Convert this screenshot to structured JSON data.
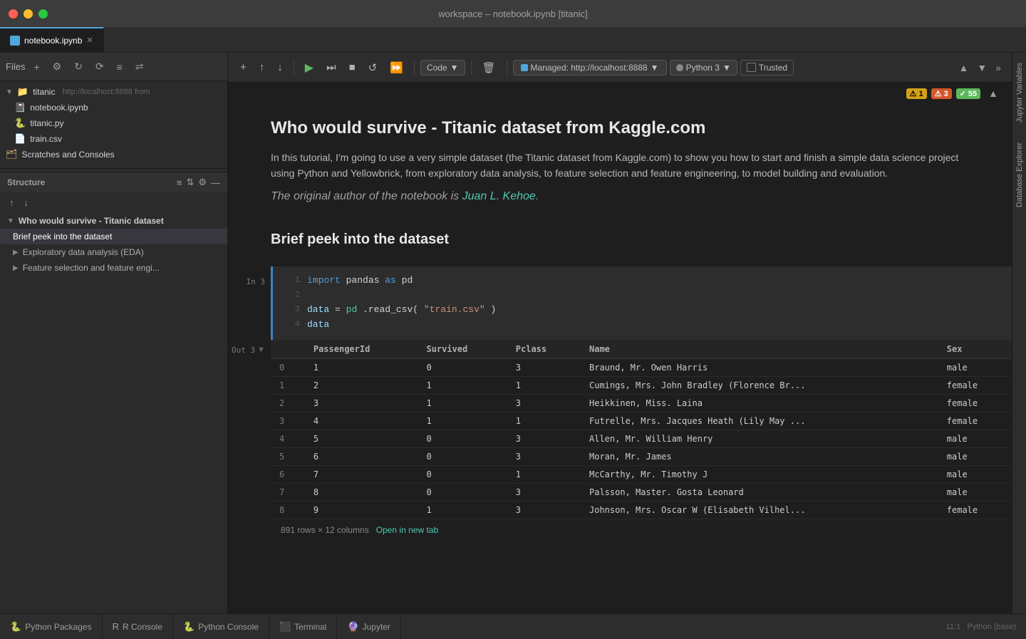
{
  "window": {
    "title": "workspace – notebook.ipynb [titanic]",
    "buttons": [
      "close",
      "minimize",
      "maximize"
    ]
  },
  "tabbar": {
    "tabs": [
      {
        "label": "notebook.ipynb",
        "active": true,
        "icon": "notebook"
      }
    ]
  },
  "sidebar": {
    "files_label": "Files",
    "tree": [
      {
        "type": "folder",
        "label": "titanic",
        "url": "http://localhost:8888 from",
        "expanded": true,
        "indent": 0
      },
      {
        "type": "notebook",
        "label": "notebook.ipynb",
        "indent": 1
      },
      {
        "type": "python",
        "label": "titanic.py",
        "indent": 1
      },
      {
        "type": "csv",
        "label": "train.csv",
        "indent": 1
      },
      {
        "type": "folder",
        "label": "Scratches and Consoles",
        "indent": 0
      }
    ]
  },
  "structure": {
    "title": "Structure",
    "items": [
      {
        "label": "Who would survive - Titanic dataset",
        "level": "h1",
        "active": false
      },
      {
        "label": "Brief peek into the dataset",
        "level": "h2",
        "active": true
      },
      {
        "label": "Exploratory data analysis (EDA)",
        "level": "h2",
        "active": false
      },
      {
        "label": "Feature selection and feature engi...",
        "level": "h2",
        "active": false
      }
    ]
  },
  "bottom_tabs": [
    {
      "label": "Python Packages",
      "icon": "python"
    },
    {
      "label": "R Console",
      "icon": "r"
    },
    {
      "label": "Python Console",
      "icon": "python"
    },
    {
      "label": "Terminal",
      "icon": "terminal"
    },
    {
      "label": "Jupyter",
      "icon": "jupyter"
    }
  ],
  "notebook_toolbar": {
    "url": "Managed: http://localhost:8888",
    "kernel": "Python 3",
    "trusted": "Trusted",
    "cell_type": "Code"
  },
  "notebook": {
    "title": "Who would survive - Titanic dataset from Kaggle.com",
    "description": "In this tutorial, I'm going to use a very simple dataset (the Titanic dataset from Kaggle.com) to show you how to start and finish a simple data science project using Python and Yellowbrick, from exploratory data analysis, to feature selection and feature engineering, to model building and evaluation.",
    "italic_text": "The original author of the notebook is ",
    "author_link": "Juan L. Kehoe",
    "author_link_end": ".",
    "h2": "Brief peek into the dataset",
    "code_cell": {
      "label": "In 3",
      "lines": [
        {
          "num": "1",
          "code": "import pandas as pd",
          "tokens": [
            {
              "t": "kw",
              "v": "import"
            },
            {
              "t": "op",
              "v": " pandas "
            },
            {
              "t": "kw",
              "v": "as"
            },
            {
              "t": "op",
              "v": " pd"
            }
          ]
        },
        {
          "num": "2",
          "code": ""
        },
        {
          "num": "3",
          "code": "data = pd.read_csv(\"train.csv\")",
          "tokens": [
            {
              "t": "var",
              "v": "data"
            },
            {
              "t": "op",
              "v": " = "
            },
            {
              "t": "bi",
              "v": "pd"
            },
            {
              "t": "op",
              "v": ".read_csv("
            },
            {
              "t": "str",
              "v": "\"train.csv\""
            },
            {
              "t": "op",
              "v": ")"
            }
          ]
        },
        {
          "num": "4",
          "code": "data",
          "tokens": [
            {
              "t": "var",
              "v": "data"
            }
          ]
        }
      ]
    },
    "output": {
      "label": "Out 3",
      "table": {
        "columns": [
          "",
          "PassengerId",
          "Survived",
          "Pclass",
          "Name",
          "Sex"
        ],
        "rows": [
          [
            "0",
            "1",
            "0",
            "3",
            "Braund, Mr. Owen Harris",
            "male"
          ],
          [
            "1",
            "2",
            "1",
            "1",
            "Cumings, Mrs. John Bradley (Florence Br...",
            "female"
          ],
          [
            "2",
            "3",
            "1",
            "3",
            "Heikkinen, Miss. Laina",
            "female"
          ],
          [
            "3",
            "4",
            "1",
            "1",
            "Futrelle, Mrs. Jacques Heath (Lily May ...",
            "female"
          ],
          [
            "4",
            "5",
            "0",
            "3",
            "Allen, Mr. William Henry",
            "male"
          ],
          [
            "5",
            "6",
            "0",
            "3",
            "Moran, Mr. James",
            "male"
          ],
          [
            "6",
            "7",
            "0",
            "1",
            "McCarthy, Mr. Timothy J",
            "male"
          ],
          [
            "7",
            "8",
            "0",
            "3",
            "Palsson, Master. Gosta Leonard",
            "male"
          ],
          [
            "8",
            "9",
            "1",
            "3",
            "Johnson, Mrs. Oscar W (Elisabeth Vilhel...",
            "female"
          ]
        ]
      },
      "footer": "891 rows × 12 columns",
      "footer_link": "Open in new tab"
    },
    "notifications": {
      "warn1": "⚠ 1",
      "warn2": "⚠ 3",
      "ok": "✓ 55"
    }
  },
  "right_sidebar": {
    "tabs": [
      "Jupyter Variables",
      "Database Explorer"
    ]
  },
  "status_bar": {
    "time": "11:1",
    "python": "Python (base)"
  }
}
